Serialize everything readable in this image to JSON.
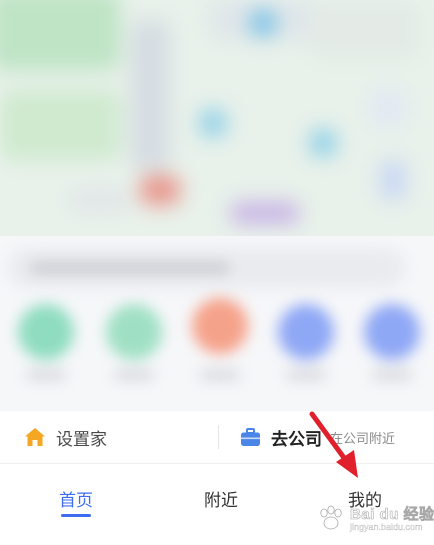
{
  "shortcuts": {
    "home_label": "设置家",
    "company_label": "去公司",
    "company_hint": "在公司附近"
  },
  "nav": {
    "home": "首页",
    "nearby": "附近",
    "mine": "我的",
    "active": "home"
  },
  "watermark": {
    "text": "Bai du 经验",
    "url": "jingyan.baidu.com"
  },
  "colors": {
    "accent": "#3d6cf0",
    "home_icon": "#f5a623",
    "company_icon": "#4a86e8",
    "annotation": "#e0202a"
  },
  "icons": {
    "home": "house-icon",
    "company": "briefcase-icon"
  }
}
